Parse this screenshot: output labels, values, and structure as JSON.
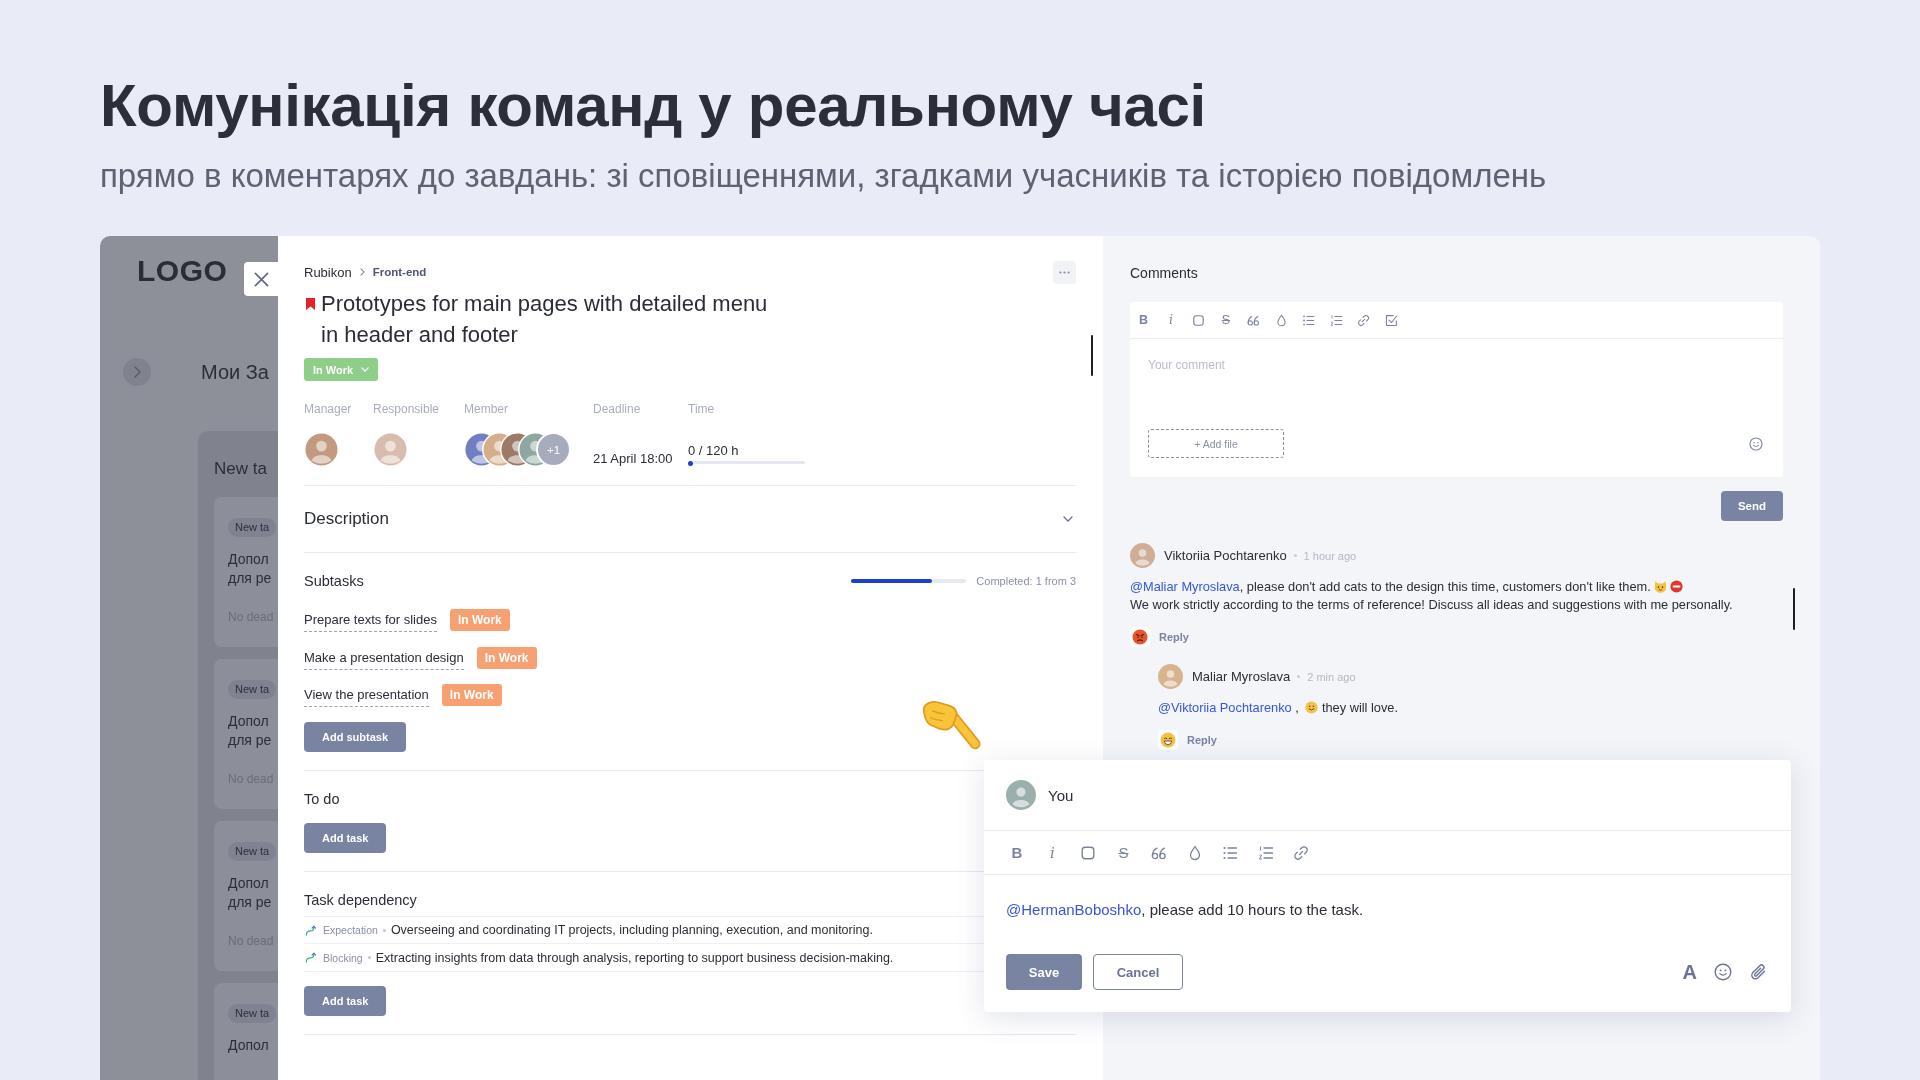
{
  "header": {
    "title": "Комунікація команд у реальному часі",
    "subtitle": "прямо в коментарях до завдань: зі сповіщеннями, згадками учасників та історією повідомлень"
  },
  "background_app": {
    "logo": "LOGO",
    "page_title": "Мои За",
    "column": {
      "title": "New ta",
      "cards": [
        {
          "tag": "New ta",
          "lines": [
            "Допол",
            "для ре"
          ],
          "deadline": "No dead"
        },
        {
          "tag": "New ta",
          "lines": [
            "Допол",
            "для ре"
          ],
          "deadline": "No dead"
        },
        {
          "tag": "New ta",
          "lines": [
            "Допол",
            "для ре"
          ],
          "deadline": "No dead"
        },
        {
          "tag": "New ta",
          "lines": [
            "Допол"
          ]
        }
      ]
    }
  },
  "task": {
    "breadcrumb": [
      "Rubikon",
      "Front-end"
    ],
    "flagged": true,
    "title": "Prototypes for main pages with detailed menu in header and footer",
    "status": "In Work",
    "fields": [
      {
        "label": "Manager",
        "kind": "people",
        "people": [
          {
            "kind": "photo"
          }
        ]
      },
      {
        "label": "Responsible",
        "kind": "people",
        "people": [
          {
            "kind": "photo"
          }
        ]
      },
      {
        "label": "Member",
        "kind": "people",
        "people": [
          {
            "kind": "photo"
          },
          {
            "kind": "photo"
          },
          {
            "kind": "photo"
          },
          {
            "kind": "photo"
          },
          {
            "kind": "more",
            "text": "+1"
          }
        ]
      },
      {
        "label": "Deadline",
        "kind": "text",
        "value": "21 April 18:00"
      },
      {
        "label": "Time",
        "kind": "progress",
        "value": "0 / 120 h",
        "level": 0.04
      }
    ],
    "description": {
      "title": "Description",
      "expanded": false
    },
    "subtasks": {
      "title": "Subtasks",
      "progress": {
        "level": 0.7,
        "text": "Completed: 1 from 3"
      },
      "items": [
        {
          "name": "Prepare texts for slides",
          "status": "In Work"
        },
        {
          "name": "Make a presentation design",
          "status": "In Work"
        },
        {
          "name": "View the presentation",
          "status": "In Work"
        }
      ],
      "add_button": "Add subtask"
    },
    "todo": {
      "title": "To do",
      "add_button": "Add task"
    },
    "dependencies": {
      "title": "Task dependency",
      "items": [
        {
          "type": "Expectation",
          "text": "Overseeing and coordinating IT projects, including planning, execution, and monitoring."
        },
        {
          "type": "Blocking",
          "text": "Extracting insights from data through analysis, reporting to support business decision-making."
        }
      ],
      "add_button": "Add task"
    }
  },
  "comments": {
    "title": "Comments",
    "editor": {
      "toolbar": [
        {
          "kind": "bold",
          "text": "B"
        },
        {
          "kind": "italic",
          "text": "i"
        },
        {
          "kind": "box"
        },
        {
          "kind": "strike",
          "text": "S"
        },
        {
          "kind": "quote"
        },
        {
          "kind": "drop"
        },
        {
          "kind": "bullets"
        },
        {
          "kind": "numbers"
        },
        {
          "kind": "link"
        },
        {
          "kind": "checklist"
        }
      ],
      "placeholder": "Your comment",
      "add_file": "+ Add file"
    },
    "send_button": "Send",
    "thread": [
      {
        "author": "Viktoriia Pochtarenko",
        "time": "1 hour ago",
        "lines": [
          [
            {
              "kind": "mention",
              "text": "@Maliar Myroslava"
            },
            {
              "kind": "text",
              "text": ", please don't add cats to the design this time, customers don't like them."
            },
            {
              "kind": "cat"
            },
            {
              "kind": "stop"
            }
          ],
          [
            {
              "kind": "text",
              "text": "We work strictly according to the terms of reference! Discuss all ideas and suggestions with me personally."
            }
          ]
        ],
        "reaction": {
          "kind": "angry"
        },
        "reply_label": "Reply",
        "replies": [
          {
            "author": "Maliar Myroslava",
            "time": "2 min ago",
            "lines": [
              [
                {
                  "kind": "mention",
                  "text": "@Viktoriia Pochtarenko"
                },
                {
                  "kind": "text",
                  "text": " , "
                },
                {
                  "kind": "smile"
                },
                {
                  "kind": "text",
                  "text": " they will love."
                }
              ]
            ],
            "reaction": {
              "kind": "grin"
            },
            "reply_label": "Reply"
          }
        ]
      }
    ]
  },
  "edit_popup": {
    "author": "You",
    "toolbar": [
      {
        "kind": "bold",
        "text": "B"
      },
      {
        "kind": "italic",
        "text": "i"
      },
      {
        "kind": "box"
      },
      {
        "kind": "strike",
        "text": "S"
      },
      {
        "kind": "quote"
      },
      {
        "kind": "drop"
      },
      {
        "kind": "bullets"
      },
      {
        "kind": "numbers"
      },
      {
        "kind": "link"
      }
    ],
    "value": [
      {
        "kind": "mention",
        "text": "@HermanBoboshko"
      },
      {
        "kind": "text",
        "text": ", please add 10 hours to the task."
      }
    ],
    "save_button": "Save",
    "cancel_button": "Cancel",
    "tools": [
      {
        "kind": "format",
        "text": "A"
      },
      {
        "kind": "emoji"
      },
      {
        "kind": "attach"
      }
    ]
  }
}
